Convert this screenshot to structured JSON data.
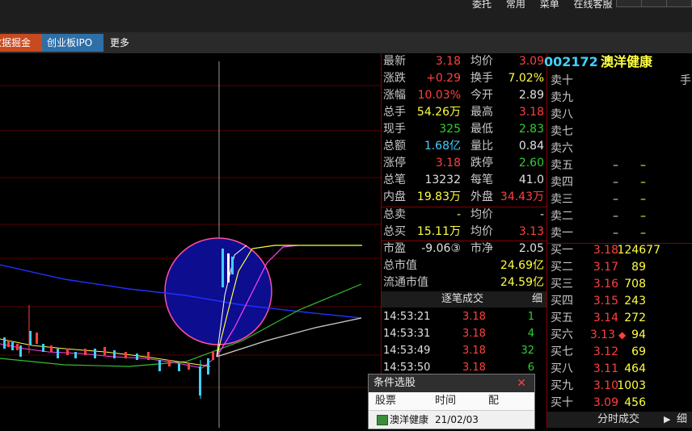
{
  "top_menu": [
    "委托",
    "常用",
    "菜单",
    "在线客服"
  ],
  "tabs": [
    {
      "label": "数据掘金",
      "bg": "#c84a1e"
    },
    {
      "label": "创业板IPO",
      "bg": "#2e6fa8"
    },
    {
      "label": "更多",
      "bg": "#2a2a2a"
    }
  ],
  "quote": {
    "rows": [
      {
        "k": "最新",
        "v1": "3.18",
        "c1": "red",
        "k2": "均价",
        "v2": "3.09",
        "c2": "red"
      },
      {
        "k": "涨跌",
        "v1": "+0.29",
        "c1": "red",
        "k2": "换手",
        "v2": "7.02%",
        "c2": "yellow"
      },
      {
        "k": "涨幅",
        "v1": "10.03%",
        "c1": "red",
        "k2": "今开",
        "v2": "2.89",
        "c2": "white"
      },
      {
        "k": "总手",
        "v1": "54.26万",
        "c1": "yellow",
        "k2": "最高",
        "v2": "3.18",
        "c2": "red"
      },
      {
        "k": "现手",
        "v1": "325",
        "c1": "green",
        "k2": "最低",
        "v2": "2.83",
        "c2": "green"
      },
      {
        "k": "总额",
        "v1": "1.68亿",
        "c1": "cyan",
        "k2": "量比",
        "v2": "0.84",
        "c2": "white"
      },
      {
        "k": "涨停",
        "v1": "3.18",
        "c1": "red",
        "k2": "跌停",
        "v2": "2.60",
        "c2": "green"
      },
      {
        "k": "总笔",
        "v1": "13232",
        "c1": "white",
        "k2": "每笔",
        "v2": "41.0",
        "c2": "white"
      },
      {
        "k": "内盘",
        "v1": "19.83万",
        "c1": "yellow",
        "k2": "外盘",
        "v2": "34.43万",
        "c2": "red"
      },
      {
        "k": "总卖",
        "v1": "-",
        "c1": "yellow",
        "k2": "均价",
        "v2": "-",
        "c2": "white"
      },
      {
        "k": "总买",
        "v1": "15.11万",
        "c1": "yellow",
        "k2": "均价",
        "v2": "3.13",
        "c2": "red"
      },
      {
        "k": "市盈",
        "v1": "-9.06③",
        "c1": "white",
        "k2": "市净",
        "v2": "2.05",
        "c2": "white"
      },
      {
        "k": "总市值",
        "v1": "",
        "c1": "white",
        "k2": "",
        "v2": "24.69亿",
        "c2": "yellow"
      },
      {
        "k": "流通市值",
        "v1": "",
        "c1": "white",
        "k2": "",
        "v2": "24.59亿",
        "c2": "yellow"
      }
    ],
    "trades_title": "逐笔成交",
    "trades_detail": "细",
    "trades": [
      {
        "t": "14:53:21",
        "p": "3.18",
        "n": "1",
        "c": "green"
      },
      {
        "t": "14:53:31",
        "p": "3.18",
        "n": "4",
        "c": "green"
      },
      {
        "t": "14:53:49",
        "p": "3.18",
        "n": "32",
        "c": "green"
      },
      {
        "t": "14:53:50",
        "p": "3.18",
        "n": "6",
        "c": "green"
      }
    ]
  },
  "book": {
    "code": "002172",
    "name": "澳洋健康",
    "hand_label": "手",
    "sells": [
      {
        "k": "卖十",
        "p": "",
        "n": ""
      },
      {
        "k": "卖九",
        "p": "",
        "n": ""
      },
      {
        "k": "卖八",
        "p": "",
        "n": ""
      },
      {
        "k": "卖七",
        "p": "",
        "n": ""
      },
      {
        "k": "卖六",
        "p": "",
        "n": ""
      },
      {
        "k": "卖五",
        "p": "–",
        "n": "–"
      },
      {
        "k": "卖四",
        "p": "–",
        "n": "–"
      },
      {
        "k": "卖三",
        "p": "–",
        "n": "–"
      },
      {
        "k": "卖二",
        "p": "–",
        "n": "–"
      },
      {
        "k": "卖一",
        "p": "–",
        "n": "–"
      }
    ],
    "buys": [
      {
        "k": "买一",
        "p": "3.18",
        "n": "124677",
        "flag": ""
      },
      {
        "k": "买二",
        "p": "3.17",
        "n": "89",
        "flag": ""
      },
      {
        "k": "买三",
        "p": "3.16",
        "n": "708",
        "flag": ""
      },
      {
        "k": "买四",
        "p": "3.15",
        "n": "243",
        "flag": ""
      },
      {
        "k": "买五",
        "p": "3.14",
        "n": "272",
        "flag": ""
      },
      {
        "k": "买六",
        "p": "3.13",
        "n": "94",
        "flag": "◆"
      },
      {
        "k": "买七",
        "p": "3.12",
        "n": "69",
        "flag": ""
      },
      {
        "k": "买八",
        "p": "3.11",
        "n": "464",
        "flag": ""
      },
      {
        "k": "买九",
        "p": "3.10",
        "n": "1003",
        "flag": ""
      },
      {
        "k": "买十",
        "p": "3.09",
        "n": "456",
        "flag": ""
      }
    ],
    "footer_label": "分时成交",
    "footer_play": "▶",
    "footer_detail": "细"
  },
  "popup": {
    "title": "条件选股",
    "close": "✕",
    "cols": [
      "股票",
      "时间",
      "配"
    ],
    "row": {
      "stock": "澳洋健康",
      "date": "21/02/03"
    }
  }
}
